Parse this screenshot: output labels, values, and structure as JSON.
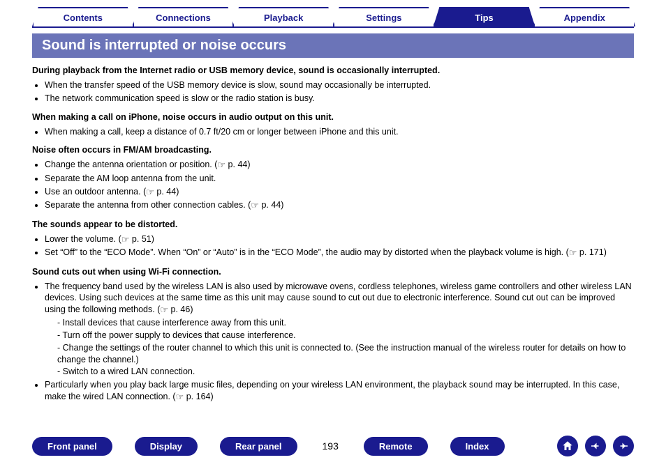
{
  "tabs": {
    "items": [
      {
        "label": "Contents",
        "active": false
      },
      {
        "label": "Connections",
        "active": false
      },
      {
        "label": "Playback",
        "active": false
      },
      {
        "label": "Settings",
        "active": false
      },
      {
        "label": "Tips",
        "active": true
      },
      {
        "label": "Appendix",
        "active": false
      }
    ]
  },
  "page_title": "Sound is interrupted or noise occurs",
  "ref": {
    "p44": "p. 44",
    "p46": "p. 46",
    "p51": "p. 51",
    "p171": "p. 171",
    "p164": "p. 164"
  },
  "sections": {
    "s1h": "During playback from the Internet radio or USB memory device, sound is occasionally interrupted.",
    "s1_1": "When the transfer speed of the USB memory device is slow, sound may occasionally be interrupted.",
    "s1_2": "The network communication speed is slow or the radio station is busy.",
    "s2h": "When making a call on iPhone, noise occurs in audio output on this unit.",
    "s2_1": "When making a call, keep a distance of 0.7 ft/20 cm or longer between iPhone and this unit.",
    "s3h": "Noise often occurs in FM/AM broadcasting.",
    "s3_1": "Change the antenna orientation or position.  (",
    "s3_2": "Separate the AM loop antenna from the unit.",
    "s3_3": "Use an outdoor antenna.  (",
    "s3_4": "Separate the antenna from other connection cables.  (",
    "s4h": "The sounds appear to be distorted.",
    "s4_1": "Lower the volume.  (",
    "s4_2a": "Set “Off” to the “ECO Mode”. When “On” or “Auto” is in the “ECO Mode”, the audio may by distorted when the playback volume is high.  (",
    "s5h": "Sound cuts out when using Wi-Fi connection.",
    "s5_1a": "The frequency band used by the wireless LAN is also used by microwave ovens, cordless telephones, wireless game controllers and other wireless LAN devices. Using such devices at the same time as this unit may cause sound to cut out due to electronic interference. Sound cut out can be improved using the following methods.  (",
    "s5_d1": "- Install devices that cause interference away from this unit.",
    "s5_d2": "- Turn off the power supply to devices that cause interference.",
    "s5_d3": "- Change the settings of the router channel to which this unit is connected to. (See the instruction manual of the wireless router for details on how to change the channel.)",
    "s5_d4": "- Switch to a wired LAN connection.",
    "s5_2a": "Particularly when you play back large music files, depending on your wireless LAN environment, the playback sound may be interrupted. In this case, make the wired LAN connection.  ("
  },
  "footer": {
    "front": "Front panel",
    "display": "Display",
    "rear": "Rear panel",
    "page": "193",
    "remote": "Remote",
    "index": "Index"
  }
}
